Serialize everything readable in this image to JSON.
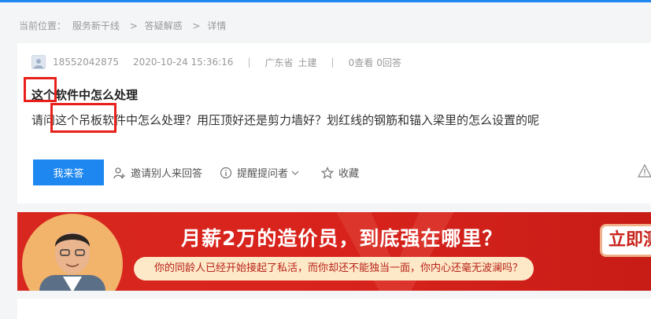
{
  "breadcrumb": {
    "prefix": "当前位置：",
    "items": [
      "服务新干线",
      "答疑解惑",
      "详情"
    ],
    "separator": ">"
  },
  "question": {
    "user": "18552042875",
    "time": "2020-10-24 15:36:16",
    "province": "广东省",
    "category": "土建",
    "views": "0查看",
    "answers": "0回答",
    "title": "这个软件中怎么处理",
    "body": "请问这个吊板软件中怎么处理？用压顶好还是剪力墙好？划红线的钢筋和锚入梁里的怎么设置的呢"
  },
  "actions": {
    "answer": "我来答",
    "invite": "邀请别人来回答",
    "remind": "提醒提问者",
    "favorite": "收藏"
  },
  "banner": {
    "headline": "月薪2万的造价员，到底强在哪里？",
    "subline": "你的同龄人已经开始接起了私活，而你却还不能独当一面，你内心还毫无波澜吗？",
    "cta": "立即测"
  },
  "colors": {
    "primary": "#1e88f0",
    "banner_red": "#d7271f",
    "highlight_box": "#e8201b"
  }
}
